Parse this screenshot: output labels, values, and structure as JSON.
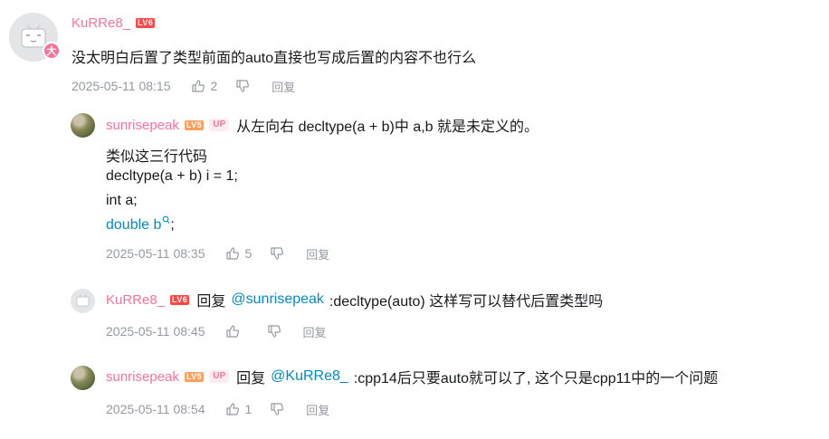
{
  "comment": {
    "avatar_badge": "大",
    "username": "KuRRe8_",
    "level": "LV6",
    "text": "没太明白后置了类型前面的auto直接也写成后置的内容不也行么",
    "date": "2025-05-11 08:15",
    "likes": "2",
    "reply_label": "回复"
  },
  "replies": [
    {
      "username": "sunrisepeak",
      "level": "LV5",
      "up_tag": "UP",
      "text_line1": "从左向右 decltype(a + b)中 a,b 就是未定义的。",
      "text_line2": "类似这三行代码",
      "text_line3": "decltype(a + b) i = 1;",
      "text_line4": "int a;",
      "link_text": "double b",
      "link_suffix": ";",
      "date": "2025-05-11 08:35",
      "likes": "5",
      "reply_label": "回复"
    },
    {
      "username": "KuRRe8_",
      "level": "LV6",
      "prefix": "回复",
      "mention": "@sunrisepeak",
      "text": ":decltype(auto) 这样写可以替代后置类型吗",
      "date": "2025-05-11 08:45",
      "reply_label": "回复"
    },
    {
      "username": "sunrisepeak",
      "level": "LV5",
      "up_tag": "UP",
      "prefix": "回复",
      "mention": "@KuRRe8_",
      "text": ":cpp14后只要auto就可以了, 这个只是cpp11中的一个问题",
      "date": "2025-05-11 08:54",
      "likes": "1",
      "reply_label": "回复"
    }
  ],
  "colors": {
    "username": "#fb7299",
    "link": "#008ac5",
    "meta": "#9499a0"
  }
}
